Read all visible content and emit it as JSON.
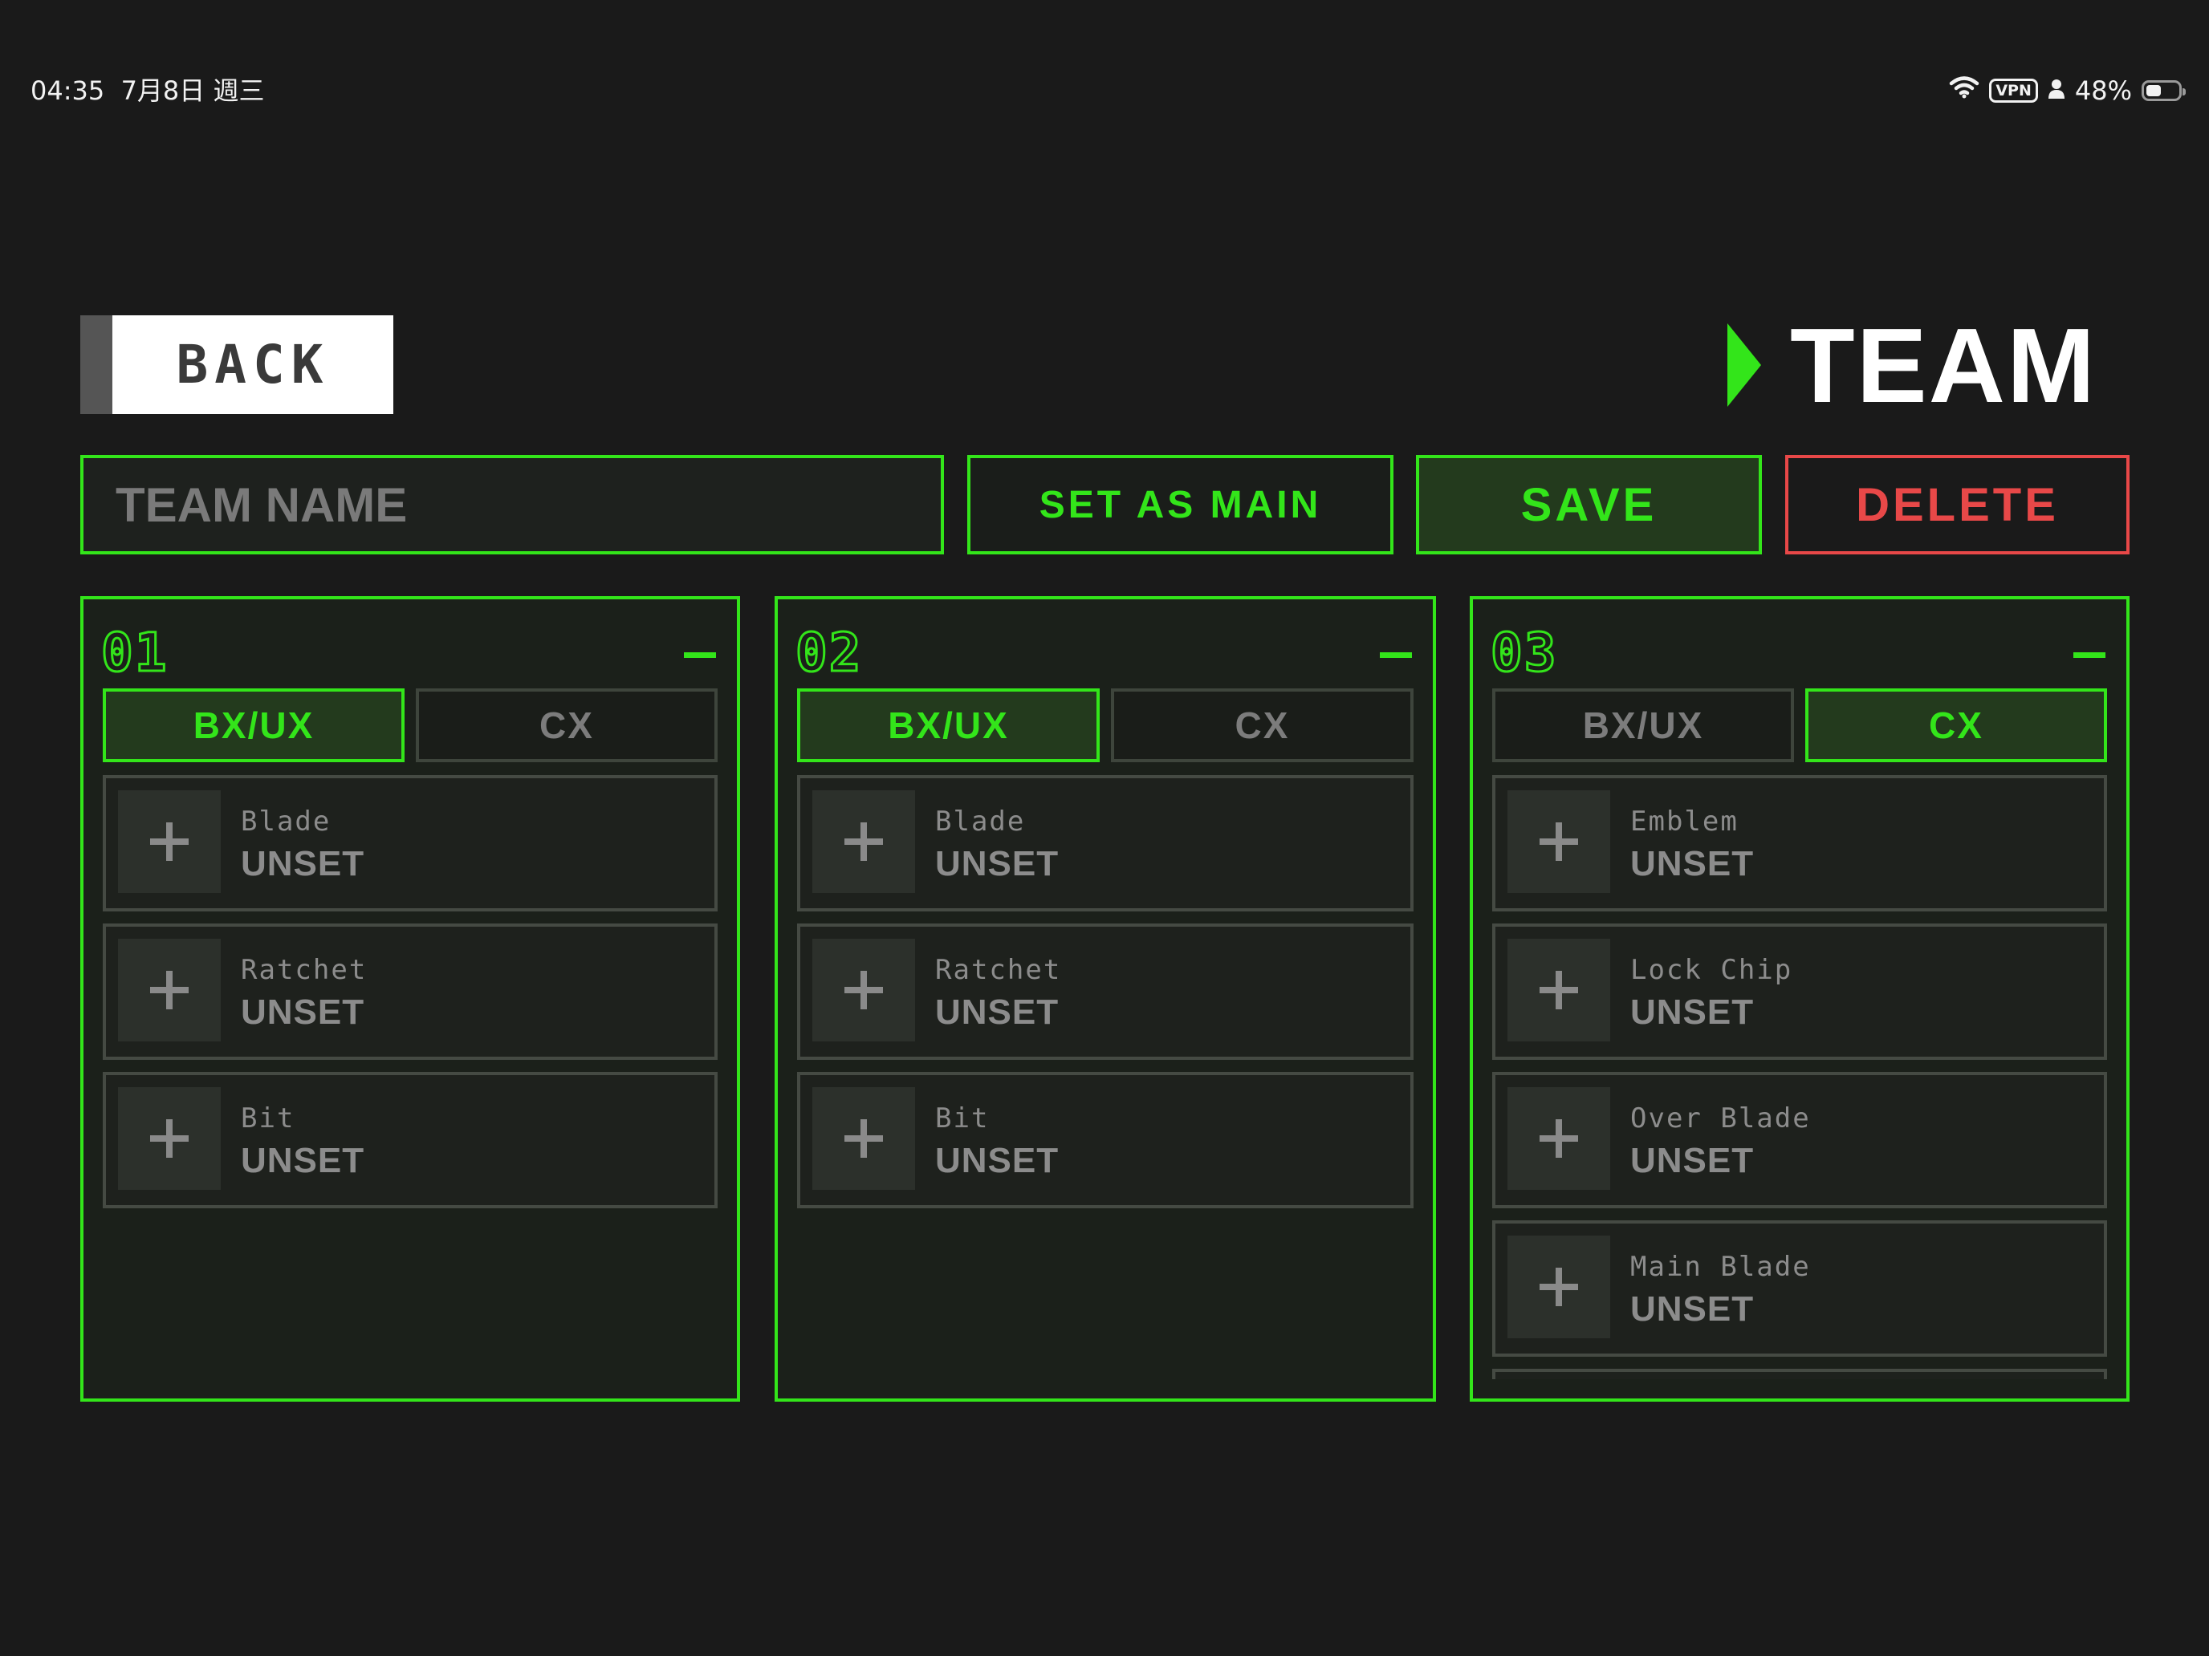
{
  "status_bar": {
    "time": "04:35",
    "date": "7月8日 週三",
    "vpn": "VPN",
    "battery": "48%",
    "battery_level": 0.48,
    "icons": [
      "wifi-icon",
      "person-icon",
      "battery-icon"
    ]
  },
  "header": {
    "back_label": "BACK",
    "title": "TEAM"
  },
  "actions": {
    "team_name_placeholder": "TEAM NAME",
    "team_name_value": "",
    "set_main_label": "SET AS MAIN",
    "save_label": "SAVE",
    "delete_label": "DELETE"
  },
  "colors": {
    "accent": "#33e51a",
    "danger": "#e84848",
    "background": "#1a1a1a",
    "panel": "#1b201a",
    "muted_text": "#8c8c8c"
  },
  "slots": [
    {
      "number": "01",
      "tabs": [
        "BX/UX",
        "CX"
      ],
      "active_tab": "BX/UX",
      "parts": [
        {
          "type": "Blade",
          "value": "UNSET"
        },
        {
          "type": "Ratchet",
          "value": "UNSET"
        },
        {
          "type": "Bit",
          "value": "UNSET"
        }
      ]
    },
    {
      "number": "02",
      "tabs": [
        "BX/UX",
        "CX"
      ],
      "active_tab": "BX/UX",
      "parts": [
        {
          "type": "Blade",
          "value": "UNSET"
        },
        {
          "type": "Ratchet",
          "value": "UNSET"
        },
        {
          "type": "Bit",
          "value": "UNSET"
        }
      ]
    },
    {
      "number": "03",
      "tabs": [
        "BX/UX",
        "CX"
      ],
      "active_tab": "CX",
      "parts": [
        {
          "type": "Emblem",
          "value": "UNSET"
        },
        {
          "type": "Lock Chip",
          "value": "UNSET"
        },
        {
          "type": "Over Blade",
          "value": "UNSET"
        },
        {
          "type": "Main Blade",
          "value": "UNSET"
        },
        {
          "type": "",
          "value": ""
        }
      ]
    }
  ]
}
